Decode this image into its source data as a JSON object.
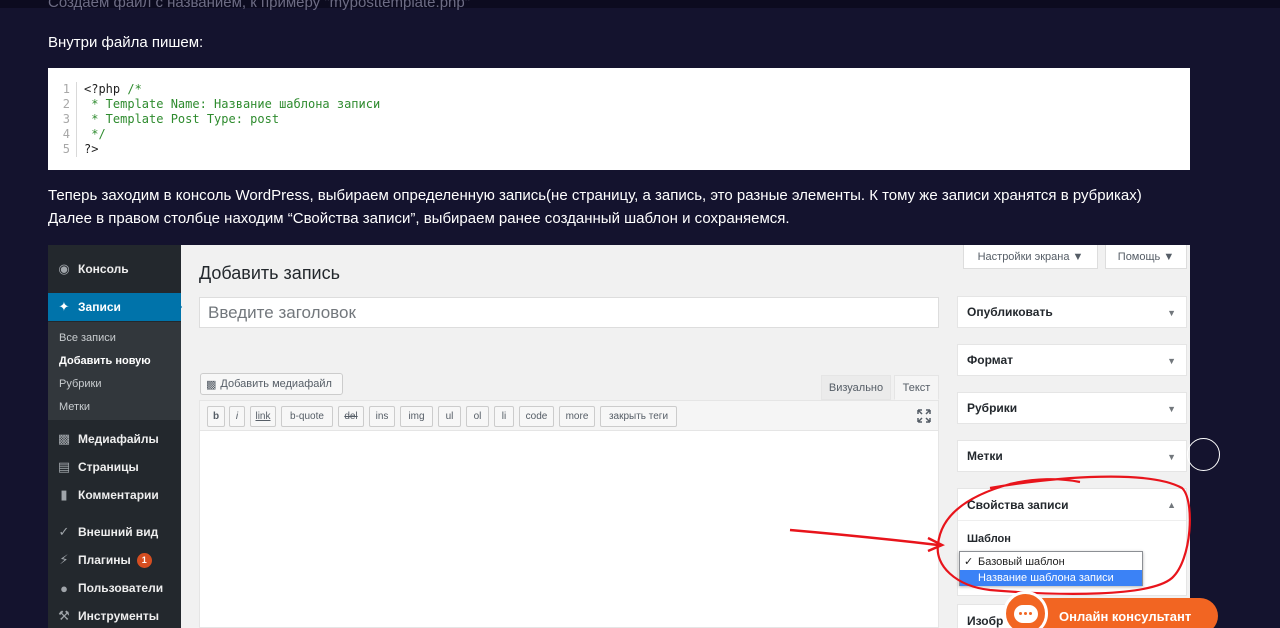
{
  "article": {
    "faded_line": "Создаем файл с названием, к примеру \"myposttemplate.php\"",
    "intro": "Внутри файла пишем:",
    "para1": "Теперь заходим в консоль WordPress, выбираем определенную запись(не страницу, а запись, это разные элементы. К тому же записи хранятся в рубриках)",
    "para2": "Далее в правом столбце находим “Свойства записи”, выбираем ранее созданный шаблон и сохраняемся."
  },
  "code": {
    "lines": [
      {
        "n": "1",
        "text": "<?php ",
        "comment": "/*"
      },
      {
        "n": "2",
        "text": "",
        "comment": " * Template Name: Название шаблона записи"
      },
      {
        "n": "3",
        "text": "",
        "comment": " * Template Post Type: post"
      },
      {
        "n": "4",
        "text": "",
        "comment": " */"
      },
      {
        "n": "5",
        "text": "?>",
        "comment": ""
      }
    ]
  },
  "wp": {
    "menu": {
      "console": "Консоль",
      "posts": "Записи",
      "sub": {
        "all": "Все записи",
        "add": "Добавить новую",
        "cats": "Рубрики",
        "tags": "Метки"
      },
      "media": "Медиафайлы",
      "pages": "Страницы",
      "comments": "Комментарии",
      "appearance": "Внешний вид",
      "plugins": "Плагины",
      "plugins_badge": "1",
      "users": "Пользователи",
      "tools": "Инструменты"
    },
    "page_title": "Добавить запись",
    "title_placeholder": "Введите заголовок",
    "add_media": "Добавить медиафайл",
    "tab_visual": "Визуально",
    "tab_text": "Текст",
    "quicktags": [
      "b",
      "i",
      "link",
      "b-quote",
      "del",
      "ins",
      "img",
      "ul",
      "ol",
      "li",
      "code",
      "more",
      "закрыть теги"
    ],
    "screen_options": "Настройки экрана ▼",
    "help": "Помощь ▼",
    "boxes": {
      "publish": "Опубликовать",
      "format": "Формат",
      "categories": "Рубрики",
      "tags": "Метки"
    },
    "post_attributes": "Свойства записи",
    "template_label": "Шаблон",
    "template_options": [
      "Базовый шаблон",
      "Название шаблона записи"
    ],
    "template_checked": "Базовый шаблон",
    "template_highlighted": "Название шаблона записи",
    "image_box_partial": "Изобр"
  },
  "chat": {
    "label": "Онлайн консультант",
    "color": "#f26522"
  },
  "colors": {
    "page_bg": "#14132e",
    "wp_accent": "#0073aa",
    "annotation": "#e8141b"
  }
}
